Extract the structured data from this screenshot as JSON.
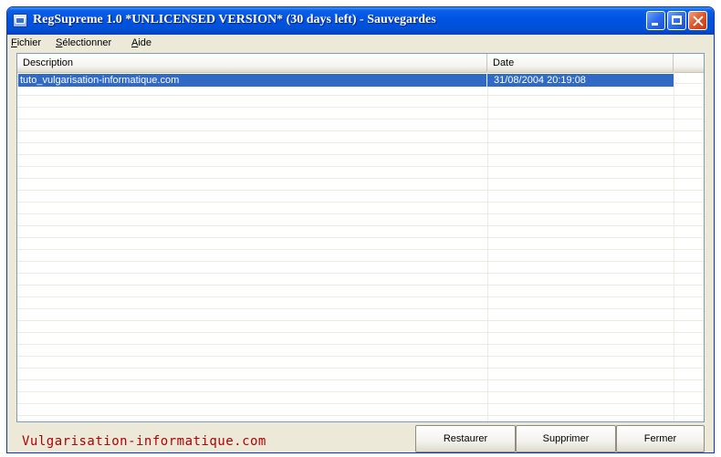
{
  "window": {
    "title": "RegSupreme 1.0  *UNLICENSED VERSION* (30 days left) - Sauvegardes"
  },
  "menu": {
    "items": [
      {
        "mnemonic": "F",
        "rest": "ichier"
      },
      {
        "mnemonic": "S",
        "rest": "électionner"
      },
      {
        "mnemonic": "A",
        "rest": "ide"
      }
    ]
  },
  "list": {
    "columns": {
      "description": "Description",
      "date": "Date"
    },
    "rows": [
      {
        "description": "tuto_vulgarisation-informatique.com",
        "date": "31/08/2004 20:19:08",
        "selected": true
      }
    ]
  },
  "footer": {
    "brand": "Vulgarisation-informatique.com"
  },
  "buttons": {
    "restore": "Restaurer",
    "delete": "Supprimer",
    "close": "Fermer"
  },
  "colors": {
    "title_bar": "#0053e1",
    "selection": "#316ac5",
    "brand_text": "#b20000",
    "window_bg": "#ece9d8"
  }
}
